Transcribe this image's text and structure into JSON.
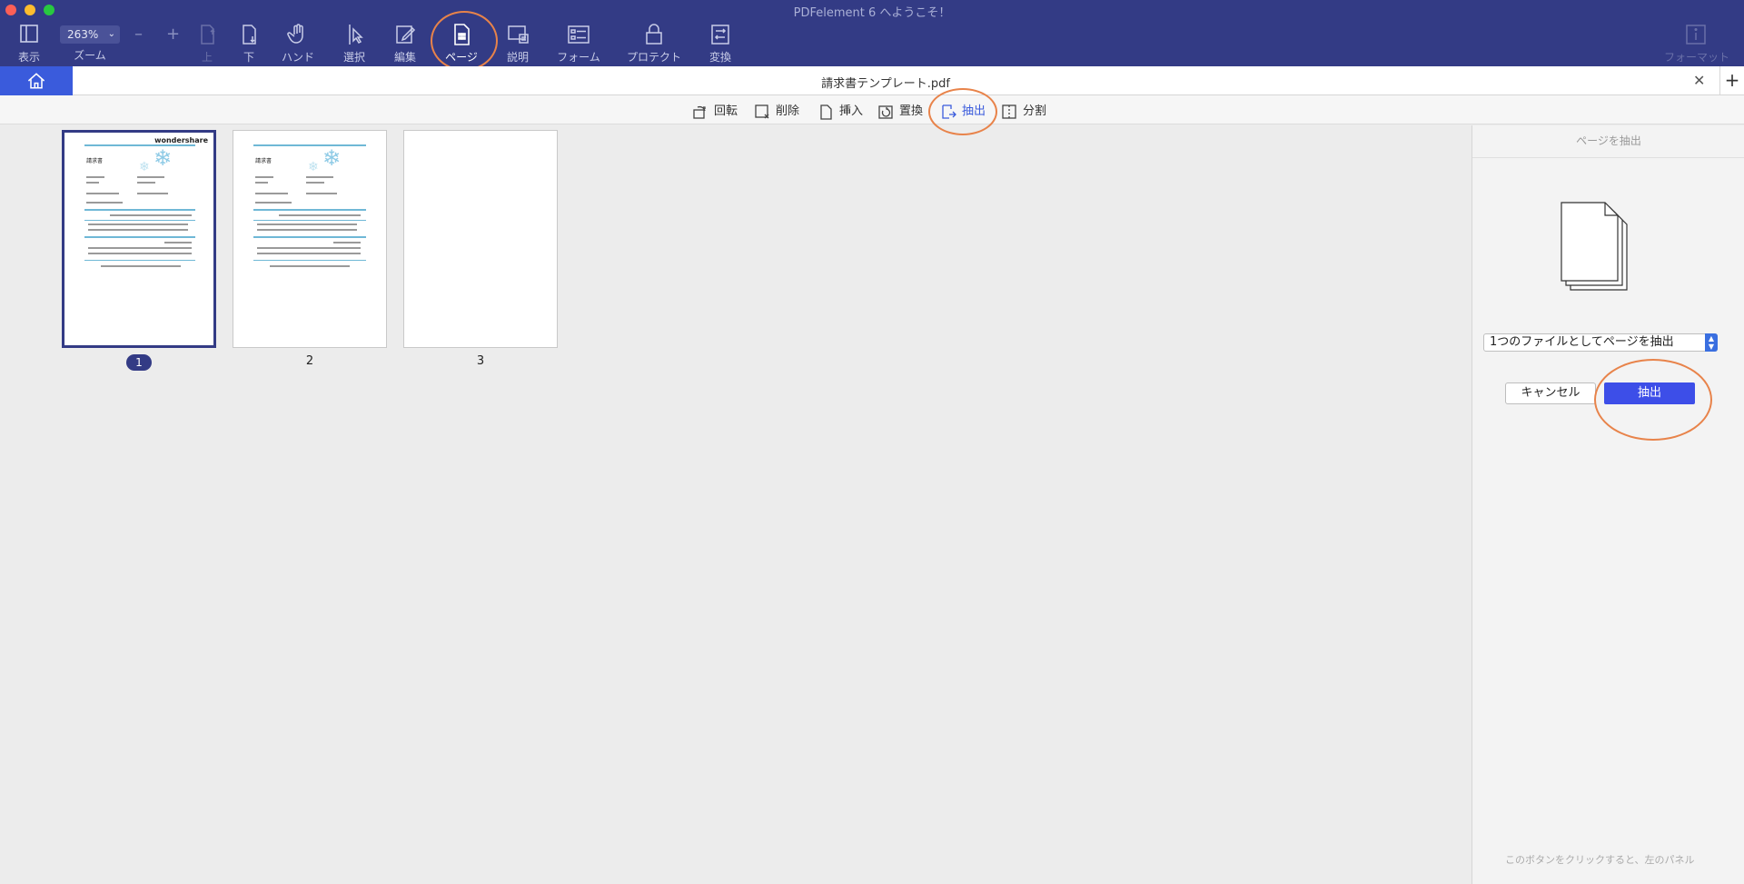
{
  "window": {
    "title": "PDFelement 6 へようこそ！"
  },
  "toolbar": {
    "view_label": "表示",
    "zoom_value": "263%",
    "zoom_label": "ズーム",
    "zoom_out": "–",
    "zoom_in": "+",
    "up_label": "上",
    "down_label": "下",
    "hand_label": "ハンド",
    "select_label": "選択",
    "edit_label": "編集",
    "page_label": "ページ",
    "comment_label": "説明",
    "form_label": "フォーム",
    "protect_label": "プロテクト",
    "convert_label": "変換",
    "format_label": "フォーマット"
  },
  "tab": {
    "title": "請求書テンプレート.pdf",
    "close": "✕",
    "add": "+"
  },
  "page_ops": {
    "rotate": "回転",
    "delete": "削除",
    "insert": "挿入",
    "replace": "置換",
    "extract": "抽出",
    "split": "分割"
  },
  "thumbnails": [
    {
      "number": "1",
      "selected": true,
      "header": "wondershare",
      "doc_title": "請求書"
    },
    {
      "number": "2",
      "selected": false,
      "doc_title": "請求書"
    },
    {
      "number": "3",
      "selected": false
    }
  ],
  "panel": {
    "title": "ページを抽出",
    "mode_value": "1つのファイルとしてページを抽出",
    "cancel": "キャンセル",
    "extract": "抽出",
    "hint": "このボタンをクリックすると、左のパネル"
  },
  "colors": {
    "toolbar_bg": "#333b85",
    "accent": "#3d4ee8",
    "highlight_circle": "#e8834a"
  }
}
